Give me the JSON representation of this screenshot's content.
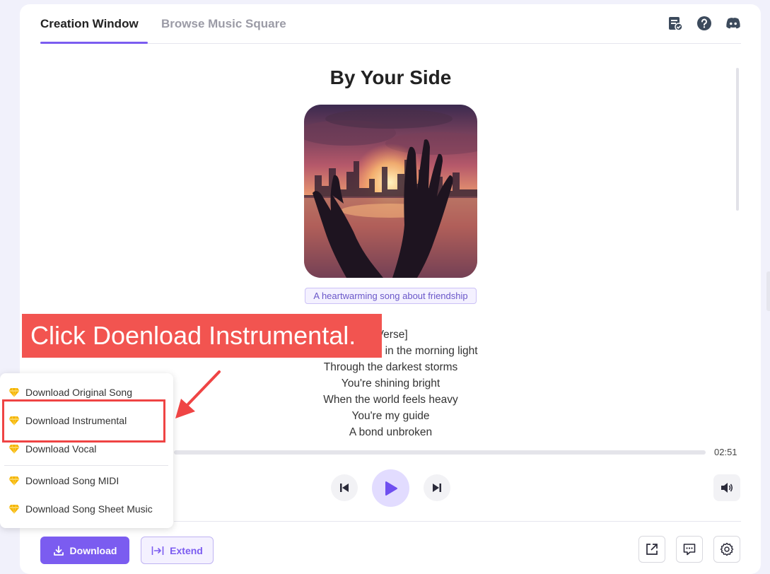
{
  "tabs": [
    {
      "label": "Creation Window",
      "active": true
    },
    {
      "label": "Browse Music Square",
      "active": false
    }
  ],
  "top_icons": [
    "task-list-icon",
    "help-icon",
    "discord-icon"
  ],
  "song": {
    "title": "By Your Side",
    "description": "A heartwarming song about friendship",
    "lyrics": [
      "[Verse]",
      "You're my friend in the morning light",
      "Through the darkest storms",
      "You're shining bright",
      "When the world feels heavy",
      "You're my guide",
      "A bond unbroken"
    ]
  },
  "annotation": {
    "banner_text": "Click Doenload Instrumental."
  },
  "player": {
    "duration": "02:51",
    "progress": 0
  },
  "download_menu": {
    "items": [
      {
        "label": "Download Original Song",
        "icon": "premium-diamond-icon"
      },
      {
        "label": "Download Instrumental",
        "icon": "premium-diamond-icon"
      },
      {
        "label": "Download Vocal",
        "icon": "premium-diamond-icon"
      },
      {
        "label": "Download Song MIDI",
        "icon": "premium-diamond-icon"
      },
      {
        "label": "Download Song Sheet Music",
        "icon": "premium-diamond-icon"
      }
    ]
  },
  "actions": {
    "download_label": "Download",
    "extend_label": "Extend"
  },
  "colors": {
    "accent": "#7b5cf0",
    "annotation_red": "#f25450",
    "diamond": "#f4b400"
  }
}
